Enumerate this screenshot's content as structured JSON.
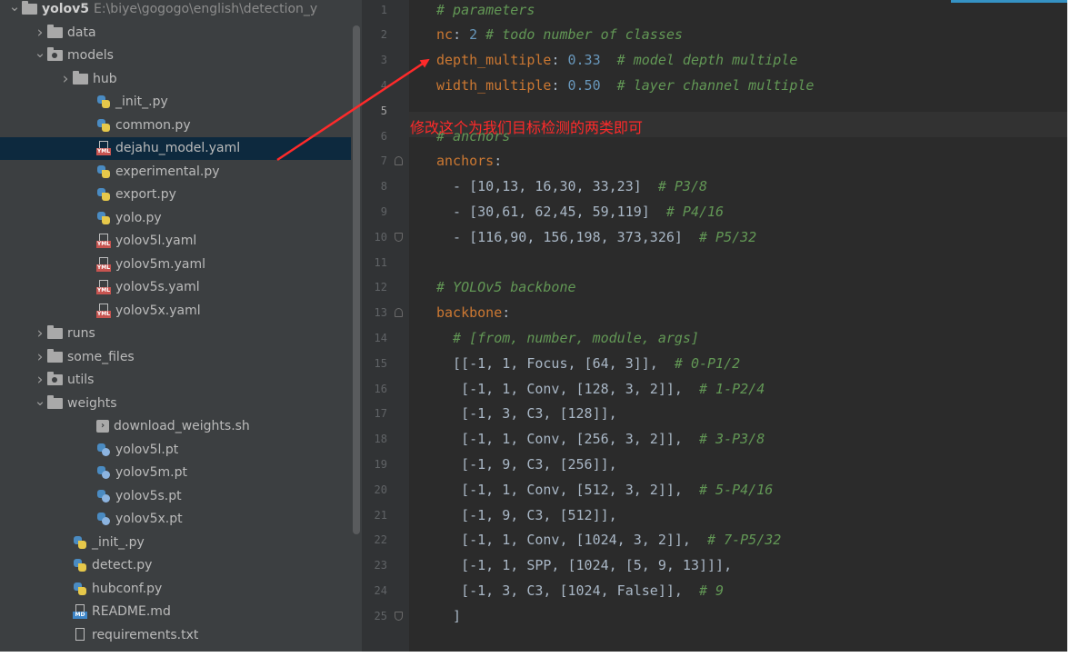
{
  "project_tree": {
    "items": [
      {
        "label": "yolov5",
        "path": "E:\\biye\\gogogo\\english\\detection_y",
        "icon": "folder-icon",
        "expanded": true,
        "level": 0,
        "root": true
      },
      {
        "label": "data",
        "icon": "folder-icon",
        "expanded": false,
        "level": 1
      },
      {
        "label": "models",
        "icon": "package-folder-icon",
        "expanded": true,
        "level": 1
      },
      {
        "label": "hub",
        "icon": "folder-icon",
        "expanded": false,
        "level": 2
      },
      {
        "label": "_init_.py",
        "icon": "python-file-icon",
        "level": 3
      },
      {
        "label": "common.py",
        "icon": "python-file-icon",
        "level": 3
      },
      {
        "label": "dejahu_model.yaml",
        "icon": "yaml-file-icon",
        "level": 3,
        "selected": true
      },
      {
        "label": "experimental.py",
        "icon": "python-file-icon",
        "level": 3
      },
      {
        "label": "export.py",
        "icon": "python-file-icon",
        "level": 3
      },
      {
        "label": "yolo.py",
        "icon": "python-file-icon",
        "level": 3
      },
      {
        "label": "yolov5l.yaml",
        "icon": "yaml-file-icon",
        "level": 3
      },
      {
        "label": "yolov5m.yaml",
        "icon": "yaml-file-icon",
        "level": 3
      },
      {
        "label": "yolov5s.yaml",
        "icon": "yaml-file-icon",
        "level": 3
      },
      {
        "label": "yolov5x.yaml",
        "icon": "yaml-file-icon",
        "level": 3
      },
      {
        "label": "runs",
        "icon": "folder-icon",
        "expanded": false,
        "level": 1
      },
      {
        "label": "some_files",
        "icon": "folder-icon",
        "expanded": false,
        "level": 1
      },
      {
        "label": "utils",
        "icon": "package-folder-icon",
        "expanded": false,
        "level": 1
      },
      {
        "label": "weights",
        "icon": "folder-icon",
        "expanded": true,
        "level": 1
      },
      {
        "label": "download_weights.sh",
        "icon": "shell-script-icon",
        "level": 3
      },
      {
        "label": "yolov5l.pt",
        "icon": "pt-file-icon",
        "level": 3
      },
      {
        "label": "yolov5m.pt",
        "icon": "pt-file-icon",
        "level": 3
      },
      {
        "label": "yolov5s.pt",
        "icon": "pt-file-icon",
        "level": 3
      },
      {
        "label": "yolov5x.pt",
        "icon": "pt-file-icon",
        "level": 3
      },
      {
        "label": "_init_.py",
        "icon": "python-file-icon",
        "level": 2
      },
      {
        "label": "detect.py",
        "icon": "python-file-icon",
        "level": 2
      },
      {
        "label": "hubconf.py",
        "icon": "python-file-icon",
        "level": 2
      },
      {
        "label": "README.md",
        "icon": "markdown-file-icon",
        "level": 2
      },
      {
        "label": "requirements.txt",
        "icon": "text-file-icon",
        "level": 2
      }
    ]
  },
  "editor": {
    "active_line": 5,
    "lines": [
      {
        "number": "1",
        "tokens": [
          {
            "t": "# parameters",
            "c": "comment"
          }
        ]
      },
      {
        "number": "2",
        "tokens": [
          {
            "t": "nc",
            "c": "key"
          },
          {
            "t": ": ",
            "c": "plain"
          },
          {
            "t": "2",
            "c": "number"
          },
          {
            "t": " # todo number of classes",
            "c": "comment"
          }
        ]
      },
      {
        "number": "3",
        "tokens": [
          {
            "t": "depth_multiple",
            "c": "key"
          },
          {
            "t": ": ",
            "c": "plain"
          },
          {
            "t": "0.33",
            "c": "number"
          },
          {
            "t": "  # model depth multiple",
            "c": "comment"
          }
        ]
      },
      {
        "number": "4",
        "tokens": [
          {
            "t": "width_multiple",
            "c": "key"
          },
          {
            "t": ": ",
            "c": "plain"
          },
          {
            "t": "0.50",
            "c": "number"
          },
          {
            "t": "  # layer channel multiple",
            "c": "comment"
          }
        ]
      },
      {
        "number": "5",
        "tokens": []
      },
      {
        "number": "6",
        "tokens": [
          {
            "t": "# anchors",
            "c": "comment"
          }
        ]
      },
      {
        "number": "7",
        "tokens": [
          {
            "t": "anchors",
            "c": "key"
          },
          {
            "t": ":",
            "c": "plain"
          }
        ],
        "fold": "start"
      },
      {
        "number": "8",
        "tokens": [
          {
            "t": "  - [10,13, 16,30, 33,23]  ",
            "c": "plain"
          },
          {
            "t": "# P3/8",
            "c": "comment"
          }
        ]
      },
      {
        "number": "9",
        "tokens": [
          {
            "t": "  - [30,61, 62,45, 59,119]  ",
            "c": "plain"
          },
          {
            "t": "# P4/16",
            "c": "comment"
          }
        ]
      },
      {
        "number": "10",
        "tokens": [
          {
            "t": "  - [116,90, 156,198, 373,326]  ",
            "c": "plain"
          },
          {
            "t": "# P5/32",
            "c": "comment"
          }
        ],
        "fold": "end"
      },
      {
        "number": "11",
        "tokens": []
      },
      {
        "number": "12",
        "tokens": [
          {
            "t": "# YOLOv5 backbone",
            "c": "comment"
          }
        ]
      },
      {
        "number": "13",
        "tokens": [
          {
            "t": "backbone",
            "c": "key"
          },
          {
            "t": ":",
            "c": "plain"
          }
        ],
        "fold": "start"
      },
      {
        "number": "14",
        "tokens": [
          {
            "t": "  # [from, number, module, args]",
            "c": "comment"
          }
        ]
      },
      {
        "number": "15",
        "tokens": [
          {
            "t": "  [[-1, 1, Focus, [64, 3]],  ",
            "c": "plain"
          },
          {
            "t": "# 0-P1/2",
            "c": "comment"
          }
        ]
      },
      {
        "number": "16",
        "tokens": [
          {
            "t": "   [-1, 1, Conv, [128, 3, 2]],  ",
            "c": "plain"
          },
          {
            "t": "# 1-P2/4",
            "c": "comment"
          }
        ]
      },
      {
        "number": "17",
        "tokens": [
          {
            "t": "   [-1, 3, C3, [128]],",
            "c": "plain"
          }
        ]
      },
      {
        "number": "18",
        "tokens": [
          {
            "t": "   [-1, 1, Conv, [256, 3, 2]],  ",
            "c": "plain"
          },
          {
            "t": "# 3-P3/8",
            "c": "comment"
          }
        ]
      },
      {
        "number": "19",
        "tokens": [
          {
            "t": "   [-1, 9, C3, [256]],",
            "c": "plain"
          }
        ]
      },
      {
        "number": "20",
        "tokens": [
          {
            "t": "   [-1, 1, Conv, [512, 3, 2]],  ",
            "c": "plain"
          },
          {
            "t": "# 5-P4/16",
            "c": "comment"
          }
        ]
      },
      {
        "number": "21",
        "tokens": [
          {
            "t": "   [-1, 9, C3, [512]],",
            "c": "plain"
          }
        ]
      },
      {
        "number": "22",
        "tokens": [
          {
            "t": "   [-1, 1, Conv, [1024, 3, 2]],  ",
            "c": "plain"
          },
          {
            "t": "# 7-P5/32",
            "c": "comment"
          }
        ]
      },
      {
        "number": "23",
        "tokens": [
          {
            "t": "   [-1, 1, SPP, [1024, [5, 9, 13]]],",
            "c": "plain"
          }
        ]
      },
      {
        "number": "24",
        "tokens": [
          {
            "t": "   [-1, 3, C3, [1024, False]],  ",
            "c": "plain"
          },
          {
            "t": "# 9",
            "c": "comment"
          }
        ]
      },
      {
        "number": "25",
        "tokens": [
          {
            "t": "  ]",
            "c": "plain"
          }
        ],
        "fold": "end"
      }
    ]
  },
  "annotation": {
    "text": "修改这个为我们目标检测的两类即可",
    "color": "#ff2a2a"
  },
  "colors": {
    "editor_bg": "#2b2b2b",
    "tree_bg": "#3c3f41",
    "selection_bg": "#0d293e",
    "comment": "#629755",
    "key": "#cc7832",
    "number": "#6897bb"
  }
}
